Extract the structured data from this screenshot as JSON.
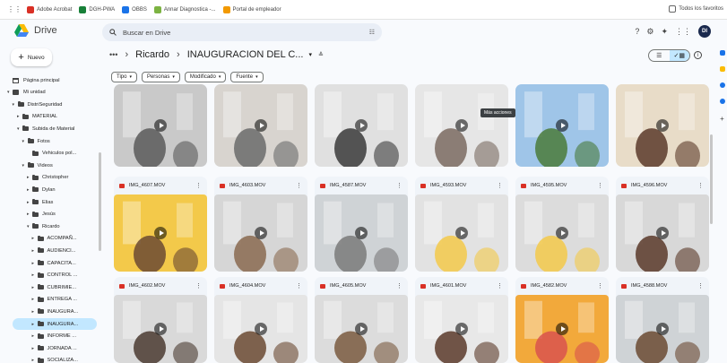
{
  "bookmarks": [
    {
      "label": "Adobe Acrobat",
      "icon": "acrobat-icon",
      "color": "#d93025"
    },
    {
      "label": "DGH-PWA",
      "icon": "dgh-icon",
      "color": "#188038"
    },
    {
      "label": "OBBS",
      "icon": "obbs-icon",
      "color": "#1a73e8"
    },
    {
      "label": "Annar Diagnostica -...",
      "icon": "annar-icon",
      "color": "#7cb342"
    },
    {
      "label": "Portal de empleador",
      "icon": "portal-icon",
      "color": "#f29900"
    }
  ],
  "bookmarks_right": "Todos los favoritos",
  "app": {
    "title": "Drive"
  },
  "search": {
    "placeholder": "Buscar en Drive"
  },
  "new_button": {
    "label": "Nuevo"
  },
  "breadcrumb": {
    "more": "•••",
    "parent": "Ricardo",
    "current": "INAUGURACION DEL C..."
  },
  "filters": [
    "Tipo",
    "Personas",
    "Modificado",
    "Fuente"
  ],
  "sidebar": [
    {
      "label": "Página principal",
      "icon": "home",
      "depth": 0,
      "arrow": ""
    },
    {
      "label": "Mi unidad",
      "icon": "mine",
      "depth": 0,
      "arrow": "▾"
    },
    {
      "label": "DistriSeguridad",
      "icon": "folder",
      "depth": 1,
      "arrow": "▾"
    },
    {
      "label": "MATERIAL",
      "icon": "folder",
      "depth": 2,
      "arrow": "▸"
    },
    {
      "label": "Subida de Material",
      "icon": "folder",
      "depth": 2,
      "arrow": "▾"
    },
    {
      "label": "Fotos",
      "icon": "folder",
      "depth": 3,
      "arrow": "▾"
    },
    {
      "label": "Vehiculos pol...",
      "icon": "folder",
      "depth": 4,
      "arrow": ""
    },
    {
      "label": "Videos",
      "icon": "folder",
      "depth": 3,
      "arrow": "▾"
    },
    {
      "label": "Christopher",
      "icon": "folder",
      "depth": 4,
      "arrow": "▸"
    },
    {
      "label": "Dylan",
      "icon": "folder",
      "depth": 4,
      "arrow": "▸"
    },
    {
      "label": "Elias",
      "icon": "folder",
      "depth": 4,
      "arrow": "▸"
    },
    {
      "label": "Jesús",
      "icon": "folder",
      "depth": 4,
      "arrow": "▸"
    },
    {
      "label": "Ricardo",
      "icon": "folder",
      "depth": 4,
      "arrow": "▾"
    },
    {
      "label": "ACOMPAÑ...",
      "icon": "folder",
      "depth": 5,
      "arrow": "▸"
    },
    {
      "label": "AUDIENCI...",
      "icon": "folder",
      "depth": 5,
      "arrow": "▸"
    },
    {
      "label": "CAPACITA...",
      "icon": "folder",
      "depth": 5,
      "arrow": "▸"
    },
    {
      "label": "CONTROL ...",
      "icon": "folder",
      "depth": 5,
      "arrow": "▸"
    },
    {
      "label": "CUBRIMIE...",
      "icon": "folder",
      "depth": 5,
      "arrow": "▸"
    },
    {
      "label": "ENTREGA ...",
      "icon": "folder",
      "depth": 5,
      "arrow": "▸"
    },
    {
      "label": "INAUGURA...",
      "icon": "folder",
      "depth": 5,
      "arrow": "▸"
    },
    {
      "label": "INAUGURA...",
      "icon": "folder",
      "depth": 5,
      "arrow": "▸",
      "selected": true
    },
    {
      "label": "INFORME ...",
      "icon": "folder",
      "depth": 5,
      "arrow": "▸"
    },
    {
      "label": "JORNADA ...",
      "icon": "folder",
      "depth": 5,
      "arrow": "▸"
    },
    {
      "label": "SOCIALIZA...",
      "icon": "folder",
      "depth": 5,
      "arrow": "▸"
    }
  ],
  "tooltip": "Más acciones",
  "files_row0": [
    {
      "name": "",
      "thumb": [
        "#c9c9c9",
        "#5a5a5a"
      ]
    },
    {
      "name": "",
      "thumb": [
        "#d8d4cf",
        "#6b6b6b"
      ]
    },
    {
      "name": "",
      "thumb": [
        "#e0e0e0",
        "#3a3a3a"
      ]
    },
    {
      "name": "",
      "thumb": [
        "#e6e6e6",
        "#7a6a60"
      ]
    },
    {
      "name": "",
      "thumb": [
        "#9fc5e8",
        "#4a7a3a"
      ]
    },
    {
      "name": "",
      "thumb": [
        "#e8dcc8",
        "#5b3a2a"
      ]
    }
  ],
  "files_row1": [
    {
      "name": "IMG_4607.MOV",
      "thumb": [
        "#f3c94a",
        "#6b4a32"
      ]
    },
    {
      "name": "IMG_4603.MOV",
      "thumb": [
        "#d6d6d6",
        "#8a6a50"
      ]
    },
    {
      "name": "IMG_4587.MOV",
      "thumb": [
        "#cfd3d6",
        "#7a7a7a"
      ]
    },
    {
      "name": "IMG_4593.MOV",
      "thumb": [
        "#e2e2e2",
        "#f3c94a"
      ]
    },
    {
      "name": "IMG_4595.MOV",
      "thumb": [
        "#dcdcdc",
        "#f3c94a"
      ]
    },
    {
      "name": "IMG_4596.MOV",
      "thumb": [
        "#d8d8d8",
        "#5b3a2a"
      ]
    }
  ],
  "files_row2": [
    {
      "name": "IMG_4602.MOV",
      "thumb": [
        "#d9d9d9",
        "#4a3a30"
      ]
    },
    {
      "name": "IMG_4604.MOV",
      "thumb": [
        "#e5e5e5",
        "#6b4a32"
      ]
    },
    {
      "name": "IMG_4605.MOV",
      "thumb": [
        "#dcdcdc",
        "#7a5a40"
      ]
    },
    {
      "name": "IMG_4601.MOV",
      "thumb": [
        "#e8e8e8",
        "#5b3a2a"
      ]
    },
    {
      "name": "IMG_4582.MOV",
      "thumb": [
        "#f2a93b",
        "#d9534f"
      ]
    },
    {
      "name": "IMG_4588.MOV",
      "thumb": [
        "#cfd3d6",
        "#6b4a32"
      ]
    }
  ]
}
